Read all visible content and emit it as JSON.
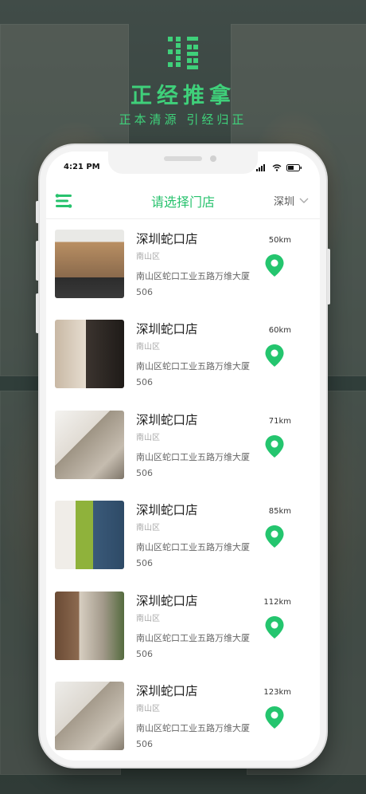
{
  "brand": {
    "name": "正经推拿",
    "slogan": "正本清源 引经归正"
  },
  "status_bar": {
    "time": "4:21 PM"
  },
  "nav": {
    "title": "请选择门店",
    "city": "深圳",
    "menu_icon": "menu-icon",
    "dropdown_icon": "chevron-down-icon"
  },
  "colors": {
    "accent": "#27c26d",
    "pin": "#24c56e"
  },
  "stores": [
    {
      "name": "深圳蛇口店",
      "district": "南山区",
      "address": "南山区蛇口工业五路万维大厦506",
      "distance": "50km"
    },
    {
      "name": "深圳蛇口店",
      "district": "南山区",
      "address": "南山区蛇口工业五路万维大厦506",
      "distance": "60km"
    },
    {
      "name": "深圳蛇口店",
      "district": "南山区",
      "address": "南山区蛇口工业五路万维大厦506",
      "distance": "71km"
    },
    {
      "name": "深圳蛇口店",
      "district": "南山区",
      "address": "南山区蛇口工业五路万维大厦506",
      "distance": "85km"
    },
    {
      "name": "深圳蛇口店",
      "district": "南山区",
      "address": "南山区蛇口工业五路万维大厦506",
      "distance": "112km"
    },
    {
      "name": "深圳蛇口店",
      "district": "南山区",
      "address": "南山区蛇口工业五路万维大厦506",
      "distance": "123km"
    }
  ]
}
